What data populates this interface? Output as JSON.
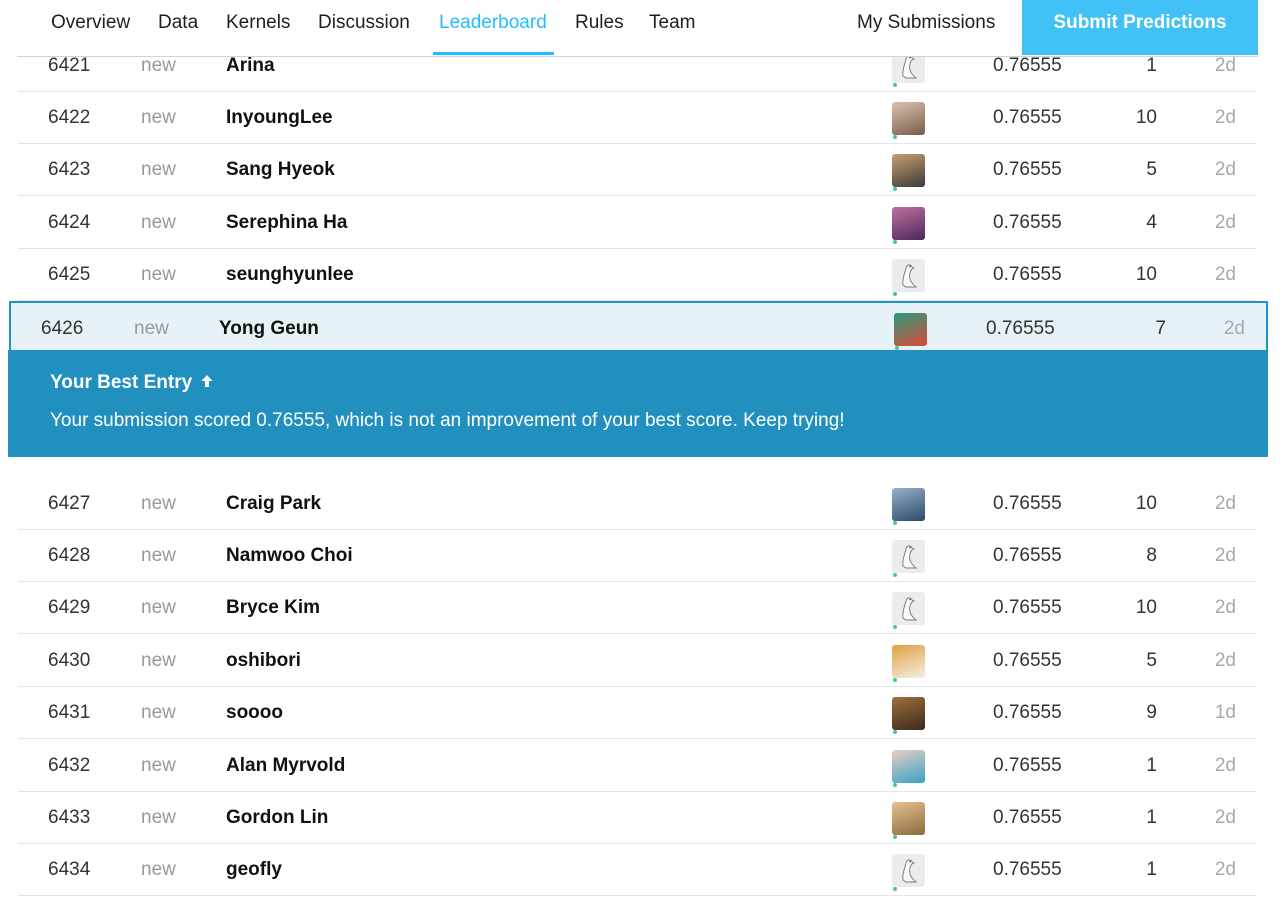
{
  "nav": {
    "tabs": [
      {
        "label": "Overview"
      },
      {
        "label": "Data"
      },
      {
        "label": "Kernels"
      },
      {
        "label": "Discussion"
      },
      {
        "label": "Leaderboard"
      },
      {
        "label": "Rules"
      },
      {
        "label": "Team"
      }
    ],
    "active_tab": "Leaderboard",
    "my_submissions": "My Submissions",
    "submit_button": "Submit Predictions",
    "accent_color": "#20beff"
  },
  "banner": {
    "title": "Your Best Entry",
    "title_icon": "arrow-up-icon",
    "message": "Your submission scored 0.76555, which is not an improvement of your best score. Keep trying!",
    "background": "#2290bf"
  },
  "rows": [
    {
      "rank": "6421",
      "change": "new",
      "team": "Arina",
      "avatar": "goose-icon",
      "score": "0.76555",
      "entries": "1",
      "last": "2d"
    },
    {
      "rank": "6422",
      "change": "new",
      "team": "InyoungLee",
      "avatar": "photo",
      "score": "0.76555",
      "entries": "10",
      "last": "2d"
    },
    {
      "rank": "6423",
      "change": "new",
      "team": "Sang Hyeok",
      "avatar": "photo",
      "score": "0.76555",
      "entries": "5",
      "last": "2d"
    },
    {
      "rank": "6424",
      "change": "new",
      "team": "Serephina Ha",
      "avatar": "photo",
      "score": "0.76555",
      "entries": "4",
      "last": "2d"
    },
    {
      "rank": "6425",
      "change": "new",
      "team": "seunghyunlee",
      "avatar": "goose-icon",
      "score": "0.76555",
      "entries": "10",
      "last": "2d"
    },
    {
      "rank": "6426",
      "change": "new",
      "team": "Yong Geun",
      "avatar": "photo",
      "score": "0.76555",
      "entries": "7",
      "last": "2d"
    },
    {
      "rank": "6427",
      "change": "new",
      "team": "Craig Park",
      "avatar": "photo",
      "score": "0.76555",
      "entries": "10",
      "last": "2d"
    },
    {
      "rank": "6428",
      "change": "new",
      "team": "Namwoo Choi",
      "avatar": "goose-icon",
      "score": "0.76555",
      "entries": "8",
      "last": "2d"
    },
    {
      "rank": "6429",
      "change": "new",
      "team": "Bryce Kim",
      "avatar": "goose-icon",
      "score": "0.76555",
      "entries": "10",
      "last": "2d"
    },
    {
      "rank": "6430",
      "change": "new",
      "team": "oshibori",
      "avatar": "photo",
      "score": "0.76555",
      "entries": "5",
      "last": "2d"
    },
    {
      "rank": "6431",
      "change": "new",
      "team": "soooo",
      "avatar": "photo",
      "score": "0.76555",
      "entries": "9",
      "last": "1d"
    },
    {
      "rank": "6432",
      "change": "new",
      "team": "Alan Myrvold",
      "avatar": "photo",
      "score": "0.76555",
      "entries": "1",
      "last": "2d"
    },
    {
      "rank": "6433",
      "change": "new",
      "team": "Gordon Lin",
      "avatar": "photo",
      "score": "0.76555",
      "entries": "1",
      "last": "2d"
    },
    {
      "rank": "6434",
      "change": "new",
      "team": "geofly",
      "avatar": "goose-icon",
      "score": "0.76555",
      "entries": "1",
      "last": "2d"
    }
  ]
}
